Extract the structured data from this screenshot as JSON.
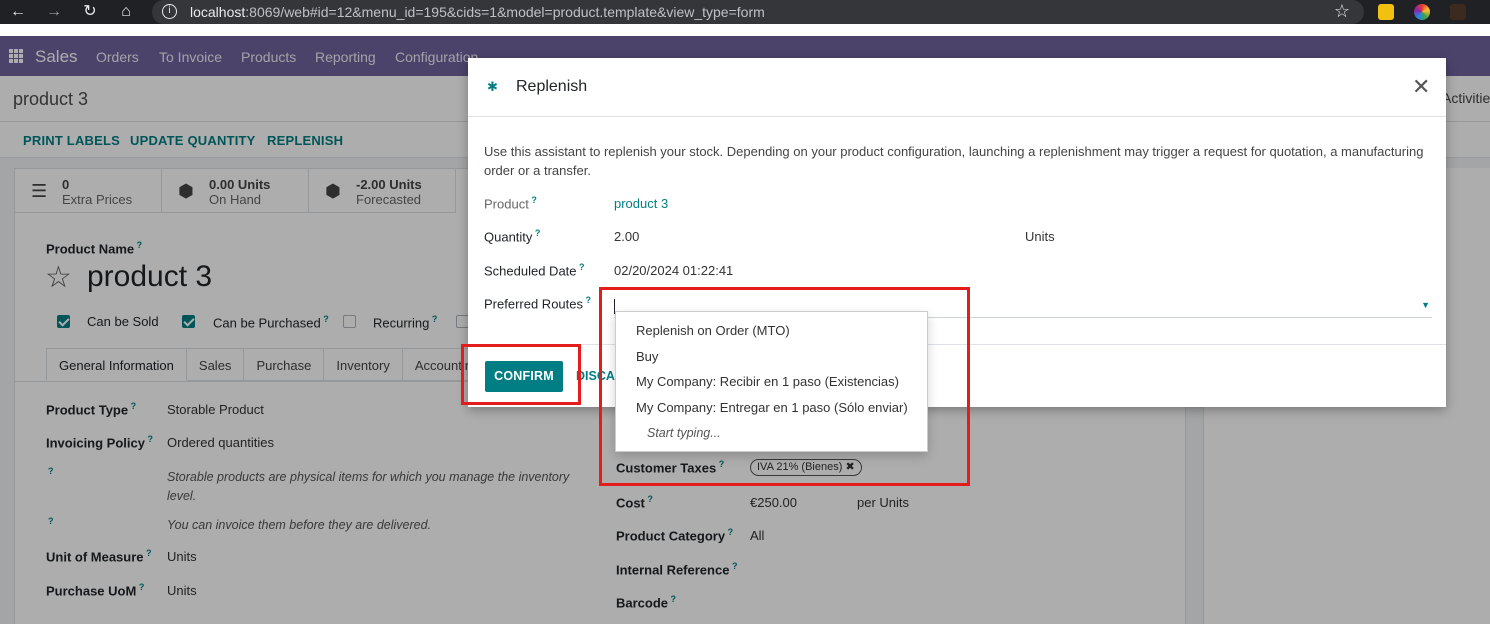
{
  "browser": {
    "url_host": "localhost",
    "url_rest": ":8069/web#id=12&menu_id=195&cids=1&model=product.template&view_type=form"
  },
  "navbar": {
    "app_name": "Sales",
    "menu": [
      "Orders",
      "To Invoice",
      "Products",
      "Reporting",
      "Configuration"
    ]
  },
  "page": {
    "breadcrumb": "product 3",
    "activities": "Activities",
    "header_buttons": [
      "PRINT LABELS",
      "UPDATE QUANTITY",
      "REPLENISH"
    ]
  },
  "stats": [
    {
      "value": "0",
      "label": "Extra Prices",
      "icon": "list-icon"
    },
    {
      "value": "0.00 Units",
      "label": "On Hand",
      "icon": "cubes-icon"
    },
    {
      "value": "-2.00 Units",
      "label": "Forecasted",
      "icon": "cubes-icon"
    }
  ],
  "form": {
    "product_name_label": "Product Name",
    "product_name": "product 3",
    "checkboxes": [
      {
        "label": "Can be Sold",
        "checked": true
      },
      {
        "label": "Can be Purchased",
        "checked": true
      },
      {
        "label": "Recurring",
        "checked": false
      }
    ],
    "tabs": [
      "General Information",
      "Sales",
      "Purchase",
      "Inventory",
      "Accounting"
    ],
    "left_fields": [
      {
        "label": "Product Type",
        "value": "Storable Product"
      },
      {
        "label": "Invoicing Policy",
        "value": "Ordered quantities"
      },
      {
        "label": "Unit of Measure",
        "value": "Units"
      },
      {
        "label": "Purchase UoM",
        "value": "Units"
      }
    ],
    "help_texts": [
      "Storable products are physical items for which you manage the inventory level.",
      "You can invoice them before they are delivered."
    ],
    "right_fields": [
      {
        "label": "Customer Taxes",
        "value": "IVA 21% (Bienes)"
      },
      {
        "label": "Cost",
        "value": "€250.00",
        "unit": "per Units"
      },
      {
        "label": "Product Category",
        "value": "All"
      },
      {
        "label": "Internal Reference",
        "value": ""
      },
      {
        "label": "Barcode",
        "value": ""
      }
    ]
  },
  "modal": {
    "title": "Replenish",
    "intro": "Use this assistant to replenish your stock. Depending on your product configuration, launching a replenishment may trigger a request for quotation, a manufacturing order or a transfer.",
    "product_label": "Product",
    "product_value": "product 3",
    "quantity_label": "Quantity",
    "quantity_value": "2.00",
    "quantity_uom": "Units",
    "date_label": "Scheduled Date",
    "date_value": "02/20/2024 01:22:41",
    "routes_label": "Preferred Routes",
    "confirm_label": "CONFIRM",
    "discard_label": "DISCARD"
  },
  "dropdown": {
    "options": [
      "Replenish on Order (MTO)",
      "Buy",
      "My Company: Recibir en 1 paso (Existencias)",
      "My Company: Entregar en 1 paso (Sólo enviar)"
    ],
    "hint": "Start typing..."
  },
  "annotation_color": "#e31c1c",
  "brand_color": "#71639e",
  "accent_color": "#017e84"
}
